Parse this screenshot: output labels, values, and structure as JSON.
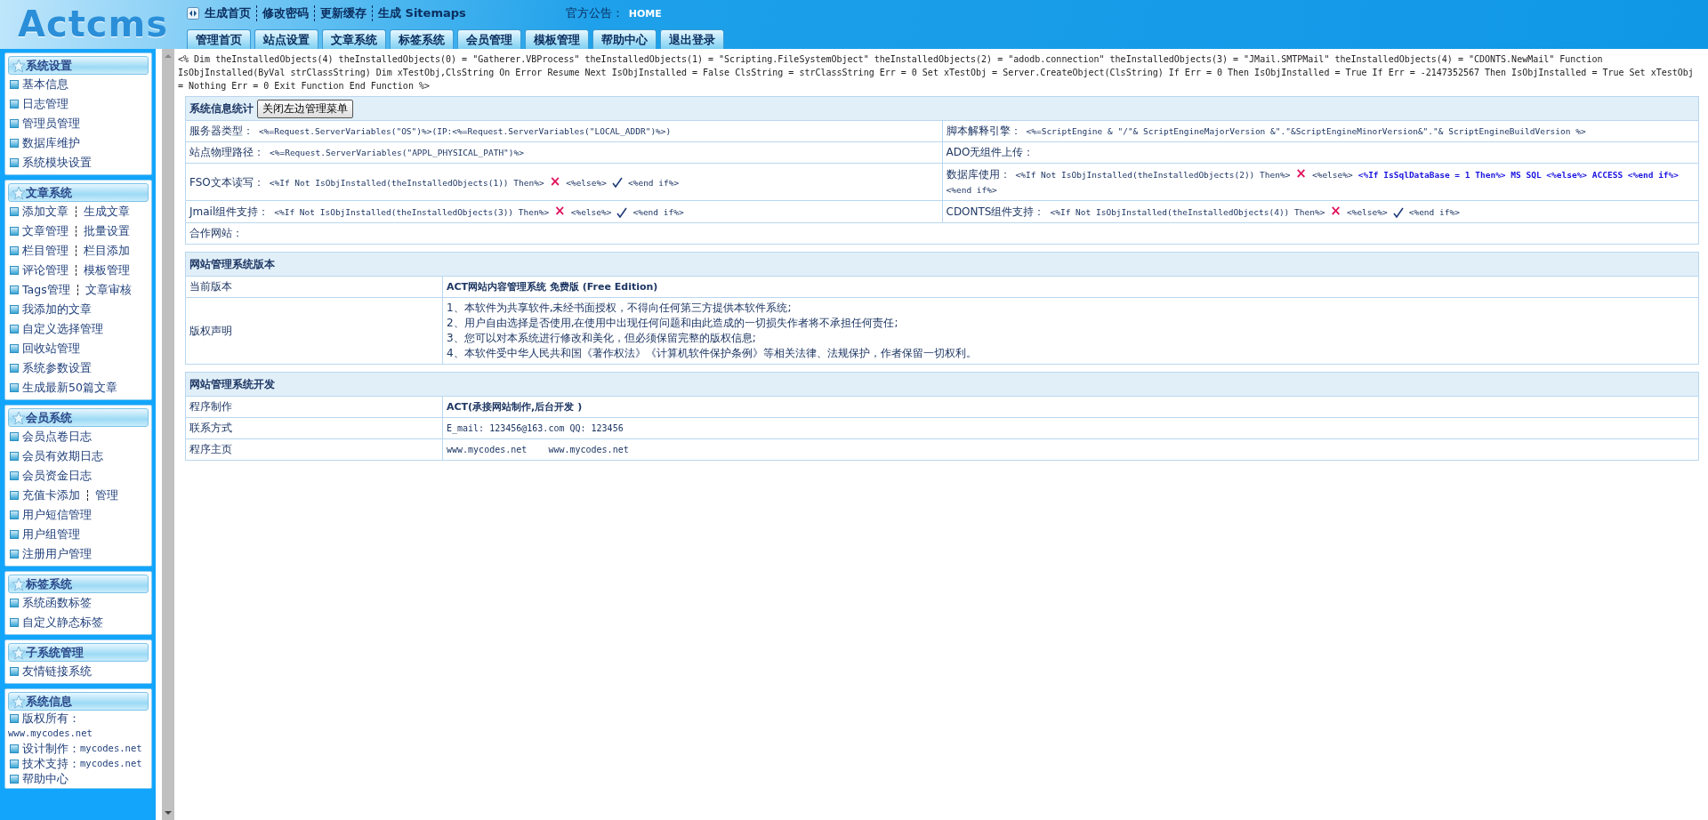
{
  "header": {
    "logo": "Actcms",
    "links": [
      "生成首页",
      "修改密码",
      "更新缓存",
      "生成 Sitemaps"
    ],
    "notice_label": "官方公告：",
    "notice": "HOME",
    "tabs": [
      {
        "label": "管理首页",
        "selected": false
      },
      {
        "label": "站点设置",
        "selected": false
      },
      {
        "label": "文章系统",
        "selected": false
      },
      {
        "label": "标签系统",
        "selected": false
      },
      {
        "label": "会员管理",
        "selected": false
      },
      {
        "label": "模板管理",
        "selected": false
      },
      {
        "label": "帮助中心",
        "selected": false
      },
      {
        "label": "退出登录",
        "selected": false
      }
    ]
  },
  "sidebar": {
    "panels": [
      {
        "title": "系统设置",
        "kind": "links",
        "items": [
          [
            "基本信息"
          ],
          [
            "日志管理"
          ],
          [
            "管理员管理"
          ],
          [
            "数据库维护"
          ],
          [
            "系统模块设置"
          ]
        ]
      },
      {
        "title": "文章系统",
        "kind": "links",
        "items": [
          [
            "添加文章",
            "生成文章"
          ],
          [
            "文章管理",
            "批量设置"
          ],
          [
            "栏目管理",
            "栏目添加"
          ],
          [
            "评论管理",
            "模板管理"
          ],
          [
            "Tags管理",
            "文章审核"
          ],
          [
            "我添加的文章"
          ],
          [
            "自定义选择管理"
          ],
          [
            "回收站管理"
          ],
          [
            "系统参数设置"
          ],
          [
            "生成最新50篇文章"
          ]
        ]
      },
      {
        "title": "会员系统",
        "kind": "links",
        "items": [
          [
            "会员点卷日志"
          ],
          [
            "会员有效期日志"
          ],
          [
            "会员资金日志"
          ],
          [
            "充值卡添加",
            "管理"
          ],
          [
            "用户短信管理"
          ],
          [
            "用户组管理"
          ],
          [
            "注册用户管理"
          ]
        ]
      },
      {
        "title": "标签系统",
        "kind": "links",
        "items": [
          [
            "系统函数标签"
          ],
          [
            "自定义静态标签"
          ]
        ]
      },
      {
        "title": "子系统管理",
        "kind": "links",
        "items": [
          [
            "友情链接系统"
          ]
        ]
      },
      {
        "title": "系统信息",
        "kind": "info",
        "items": [
          {
            "label": "版权所有：",
            "value": "www.mycodes.net"
          },
          {
            "label": "设计制作：",
            "value": "mycodes.net"
          },
          {
            "label": "技术支持：",
            "value": "mycodes.net"
          },
          {
            "label": "帮助中心"
          }
        ]
      }
    ]
  },
  "main": {
    "script_text": "<% Dim theInstalledObjects(4) theInstalledObjects(0) = \"Gatherer.VBProcess\" theInstalledObjects(1) = \"Scripting.FileSystemObject\" theInstalledObjects(2) = \"adodb.connection\" theInstalledObjects(3) = \"JMail.SMTPMail\" theInstalledObjects(4) = \"CDONTS.NewMail\" Function IsObjInstalled(ByVal strClassString) Dim xTestObj,ClsString On Error Resume Next IsObjInstalled = False ClsString = strClassString Err = 0 Set xTestObj = Server.CreateObject(ClsString) If Err = 0 Then IsObjInstalled = True If Err = -2147352567 Then IsObjInstalled = True Set xTestObj = Nothing Err = 0 Exit Function End Function %>",
    "system_info": {
      "title": "系统信息统计",
      "button": "关闭左边管理菜单",
      "rows": [
        [
          {
            "label": "服务器类型：",
            "parts": [
              {
                "kind": "code",
                "text": "<%=Request.ServerVariables(\"OS\")%>(IP:<%=Request.ServerVariables(\"LOCAL_ADDR\")%>)"
              }
            ]
          },
          {
            "label": "脚本解释引擎：",
            "parts": [
              {
                "kind": "code",
                "text": "<%=ScriptEngine & \"/\"& ScriptEngineMajorVersion &\".\"&ScriptEngineMinorVersion&\".\"& ScriptEngineBuildVersion %>"
              }
            ]
          }
        ],
        [
          {
            "label": "站点物理路径：",
            "parts": [
              {
                "kind": "code",
                "text": "<%=Request.ServerVariables(\"APPL_PHYSICAL_PATH\")%>"
              }
            ]
          },
          {
            "label": "ADO无组件上传："
          }
        ],
        [
          {
            "label": "FSO文本读写：",
            "parts": [
              {
                "kind": "code",
                "text": "<%If Not IsObjInstalled(theInstalledObjects(1)) Then%>"
              },
              {
                "kind": "cross",
                "text": "×"
              },
              {
                "kind": "code",
                "text": "<%else%>"
              },
              {
                "kind": "check"
              },
              {
                "kind": "code",
                "text": "<%end if%>"
              }
            ]
          },
          {
            "label": "数据库使用：",
            "parts": [
              {
                "kind": "code",
                "text": "<%If Not IsObjInstalled(theInstalledObjects(2)) Then%>"
              },
              {
                "kind": "cross",
                "text": "×"
              },
              {
                "kind": "code",
                "text": "<%else%>"
              },
              {
                "kind": "bold",
                "text": "<%If IsSqlDataBase = 1 Then%> MS SQL <%else%> ACCESS <%end if%>"
              },
              {
                "kind": "code",
                "text": "<%end if%>"
              }
            ]
          }
        ],
        [
          {
            "label": "Jmail组件支持：",
            "parts": [
              {
                "kind": "code",
                "text": "<%If Not IsObjInstalled(theInstalledObjects(3)) Then%>"
              },
              {
                "kind": "cross",
                "text": "×"
              },
              {
                "kind": "code",
                "text": "<%else%>"
              },
              {
                "kind": "check"
              },
              {
                "kind": "code",
                "text": "<%end if%>"
              }
            ]
          },
          {
            "label": "CDONTS组件支持：",
            "parts": [
              {
                "kind": "code",
                "text": "<%If Not IsObjInstalled(theInstalledObjects(4)) Then%>"
              },
              {
                "kind": "cross",
                "text": "×"
              },
              {
                "kind": "code",
                "text": "<%else%>"
              },
              {
                "kind": "check"
              },
              {
                "kind": "code",
                "text": "<%end if%>"
              }
            ]
          }
        ],
        [
          {
            "label": "合作网站：",
            "colspan": 2
          }
        ]
      ]
    },
    "sections": [
      {
        "title": "网站管理系统版本",
        "rows": [
          {
            "label": "当前版本",
            "kind": "bold",
            "lines": [
              "ACT网站内容管理系统 免费版 (Free Edition)"
            ]
          },
          {
            "label": "版权声明",
            "kind": "plain",
            "lines": [
              "1、本软件为共享软件,未经书面授权，不得向任何第三方提供本软件系统;",
              "2、用户自由选择是否使用,在使用中出现任何问题和由此造成的一切损失作者将不承担任何责任;",
              "3、您可以对本系统进行修改和美化，但必须保留完整的版权信息;",
              "4、本软件受中华人民共和国《著作权法》《计算机软件保护条例》等相关法律、法规保护，作者保留一切权利。"
            ]
          }
        ]
      },
      {
        "title": "网站管理系统开发",
        "rows": [
          {
            "label": "程序制作",
            "kind": "bold",
            "lines": [
              "ACT(承接网站制作,后台开发 )"
            ]
          },
          {
            "label": "联系方式",
            "kind": "code",
            "lines": [
              "E_mail: 123456@163.com QQ: 123456"
            ]
          },
          {
            "label": "程序主页",
            "kind": "code",
            "lines": [
              "www.mycodes.net    www.mycodes.net"
            ]
          }
        ]
      }
    ]
  }
}
